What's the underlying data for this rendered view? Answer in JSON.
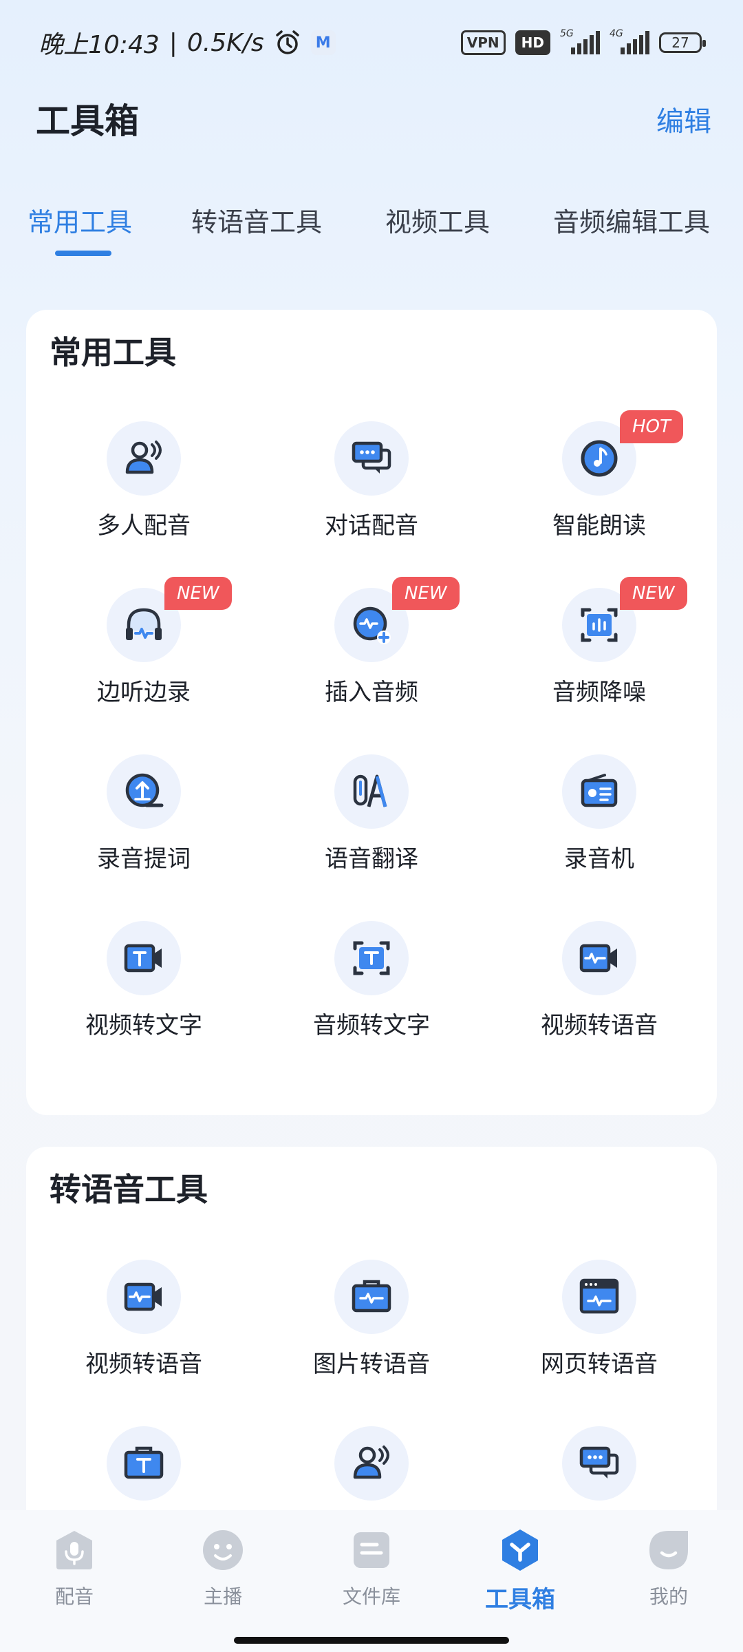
{
  "status_bar": {
    "time": "晚上10:43",
    "net_speed": "0.5K/s",
    "vpn": "VPN",
    "hd": "HD",
    "sig1": "5G",
    "sig2": "4G",
    "battery": "27"
  },
  "header": {
    "title": "工具箱",
    "edit_label": "编辑"
  },
  "tabs": [
    {
      "label": "常用工具",
      "active": true
    },
    {
      "label": "转语音工具",
      "active": false
    },
    {
      "label": "视频工具",
      "active": false
    },
    {
      "label": "音频编辑工具",
      "active": false
    }
  ],
  "common_tools": {
    "title": "常用工具",
    "items": [
      {
        "label": "多人配音",
        "icon": "multi-person-icon"
      },
      {
        "label": "对话配音",
        "icon": "chat-bubbles-icon"
      },
      {
        "label": "智能朗读",
        "icon": "music-disc-icon",
        "tag": "HOT"
      },
      {
        "label": "边听边录",
        "icon": "headphones-icon",
        "tag": "NEW"
      },
      {
        "label": "插入音频",
        "icon": "audio-plus-icon",
        "tag": "NEW"
      },
      {
        "label": "音频降噪",
        "icon": "noise-reduction-icon",
        "tag": "NEW"
      },
      {
        "label": "录音提词",
        "icon": "teleprompter-icon"
      },
      {
        "label": "语音翻译",
        "icon": "translate-icon"
      },
      {
        "label": "录音机",
        "icon": "radio-icon"
      },
      {
        "label": "视频转文字",
        "icon": "video-text-icon"
      },
      {
        "label": "音频转文字",
        "icon": "audio-text-icon"
      },
      {
        "label": "视频转语音",
        "icon": "video-audio-icon"
      }
    ]
  },
  "tts_tools": {
    "title": "转语音工具",
    "items": [
      {
        "label": "视频转语音",
        "icon": "video-audio-icon"
      },
      {
        "label": "图片转语音",
        "icon": "image-audio-icon"
      },
      {
        "label": "网页转语音",
        "icon": "webpage-audio-icon"
      },
      {
        "label": "",
        "icon": "text-audio-icon"
      },
      {
        "label": "",
        "icon": "multi-person-icon"
      },
      {
        "label": "",
        "icon": "chat-bubbles-icon"
      }
    ]
  },
  "bottom_nav": [
    {
      "label": "配音",
      "icon": "dubbing-icon",
      "active": false
    },
    {
      "label": "主播",
      "icon": "anchor-face-icon",
      "active": false
    },
    {
      "label": "文件库",
      "icon": "file-library-icon",
      "active": false
    },
    {
      "label": "工具箱",
      "icon": "toolbox-icon",
      "active": true
    },
    {
      "label": "我的",
      "icon": "profile-icon",
      "active": false
    }
  ],
  "colors": {
    "accent": "#2f7fe2",
    "tag": "#f0575a",
    "icon_dark": "#2b3340"
  }
}
